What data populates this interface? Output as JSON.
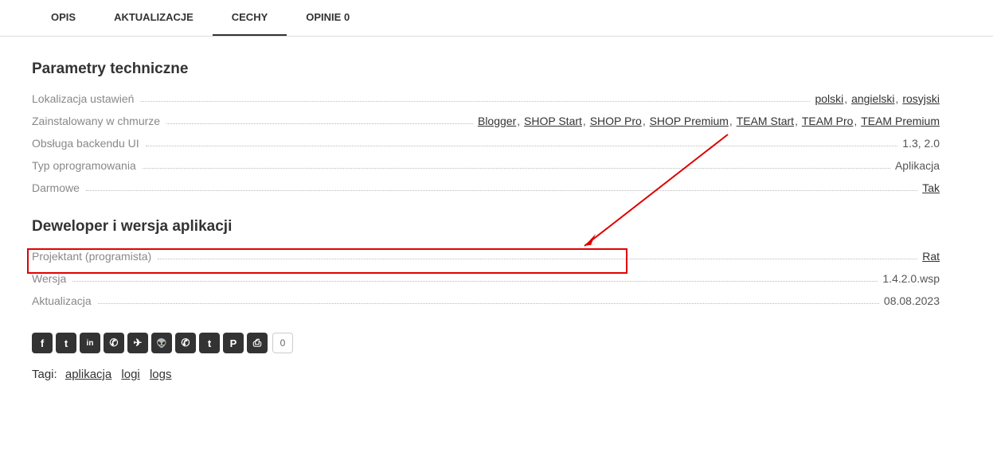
{
  "tabs": {
    "items": [
      {
        "label": "OPIS",
        "active": false
      },
      {
        "label": "AKTUALIZACJE",
        "active": false
      },
      {
        "label": "CECHY",
        "active": true
      },
      {
        "label": "OPINIE 0",
        "active": false
      }
    ]
  },
  "tech_params": {
    "title": "Parametry techniczne",
    "rows": {
      "localization": {
        "label": "Lokalizacja ustawień",
        "links": [
          "polski",
          "angielski",
          "rosyjski"
        ]
      },
      "cloud": {
        "label": "Zainstalowany w chmurze",
        "links": [
          "Blogger",
          "SHOP Start",
          "SHOP Pro",
          "SHOP Premium",
          "TEAM Start",
          "TEAM Pro",
          "TEAM Premium"
        ]
      },
      "backend": {
        "label": "Obsługa backendu UI",
        "value": "1.3, 2.0"
      },
      "software_type": {
        "label": "Typ oprogramowania",
        "value": "Aplikacja"
      },
      "free": {
        "label": "Darmowe",
        "link": "Tak"
      }
    }
  },
  "dev_section": {
    "title": "Deweloper i wersja aplikacji",
    "rows": {
      "designer": {
        "label": "Projektant (programista)",
        "link": "Rat"
      },
      "version": {
        "label": "Wersja",
        "value": "1.4.2.0.wsp"
      },
      "update": {
        "label": "Aktualizacja",
        "value": "08.08.2023"
      }
    }
  },
  "share": {
    "icons": [
      {
        "name": "facebook-icon",
        "glyph": "f"
      },
      {
        "name": "twitter-icon",
        "glyph": "t"
      },
      {
        "name": "linkedin-icon",
        "glyph": "in"
      },
      {
        "name": "whatsapp-icon",
        "glyph": "✆"
      },
      {
        "name": "telegram-icon",
        "glyph": "✈"
      },
      {
        "name": "reddit-icon",
        "glyph": "👽"
      },
      {
        "name": "viber-icon",
        "glyph": "✆"
      },
      {
        "name": "tumblr-icon",
        "glyph": "t"
      },
      {
        "name": "pinterest-icon",
        "glyph": "P"
      },
      {
        "name": "print-icon",
        "glyph": "⎙"
      }
    ],
    "count": "0"
  },
  "tags": {
    "label": "Tagi:",
    "items": [
      "aplikacja",
      "logi",
      "logs"
    ]
  },
  "annotation": {
    "highlight_row": "designer"
  }
}
